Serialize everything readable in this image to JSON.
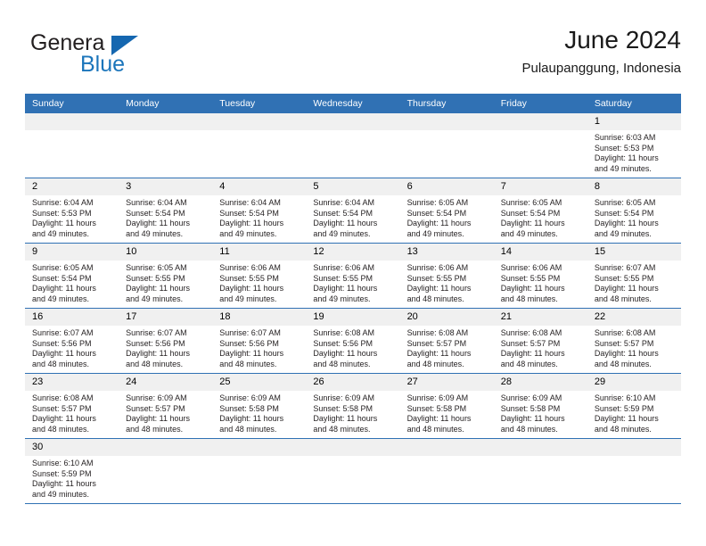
{
  "brand": {
    "name_top": "General",
    "name_bottom": "Blue",
    "accent_color": "#1b75bb"
  },
  "header": {
    "title": "June 2024",
    "subtitle": "Pulaupanggung, Indonesia"
  },
  "theme": {
    "header_blue": "#3071b4",
    "daynum_gray": "#f0f0f0",
    "text": "#231f20"
  },
  "weekday_headers": [
    "Sunday",
    "Monday",
    "Tuesday",
    "Wednesday",
    "Thursday",
    "Friday",
    "Saturday"
  ],
  "labels": {
    "sunrise_prefix": "Sunrise:",
    "sunset_prefix": "Sunset:",
    "daylight_prefix": "Daylight:"
  },
  "weeks": [
    [
      {
        "day": "",
        "empty": true,
        "sunrise": "",
        "sunset": "",
        "daylight_line1": "",
        "daylight_line2": ""
      },
      {
        "day": "",
        "empty": true,
        "sunrise": "",
        "sunset": "",
        "daylight_line1": "",
        "daylight_line2": ""
      },
      {
        "day": "",
        "empty": true,
        "sunrise": "",
        "sunset": "",
        "daylight_line1": "",
        "daylight_line2": ""
      },
      {
        "day": "",
        "empty": true,
        "sunrise": "",
        "sunset": "",
        "daylight_line1": "",
        "daylight_line2": ""
      },
      {
        "day": "",
        "empty": true,
        "sunrise": "",
        "sunset": "",
        "daylight_line1": "",
        "daylight_line2": ""
      },
      {
        "day": "",
        "empty": true,
        "sunrise": "",
        "sunset": "",
        "daylight_line1": "",
        "daylight_line2": ""
      },
      {
        "day": "1",
        "empty": false,
        "sunrise": "Sunrise: 6:03 AM",
        "sunset": "Sunset: 5:53 PM",
        "daylight_line1": "Daylight: 11 hours",
        "daylight_line2": "and 49 minutes."
      }
    ],
    [
      {
        "day": "2",
        "empty": false,
        "sunrise": "Sunrise: 6:04 AM",
        "sunset": "Sunset: 5:53 PM",
        "daylight_line1": "Daylight: 11 hours",
        "daylight_line2": "and 49 minutes."
      },
      {
        "day": "3",
        "empty": false,
        "sunrise": "Sunrise: 6:04 AM",
        "sunset": "Sunset: 5:54 PM",
        "daylight_line1": "Daylight: 11 hours",
        "daylight_line2": "and 49 minutes."
      },
      {
        "day": "4",
        "empty": false,
        "sunrise": "Sunrise: 6:04 AM",
        "sunset": "Sunset: 5:54 PM",
        "daylight_line1": "Daylight: 11 hours",
        "daylight_line2": "and 49 minutes."
      },
      {
        "day": "5",
        "empty": false,
        "sunrise": "Sunrise: 6:04 AM",
        "sunset": "Sunset: 5:54 PM",
        "daylight_line1": "Daylight: 11 hours",
        "daylight_line2": "and 49 minutes."
      },
      {
        "day": "6",
        "empty": false,
        "sunrise": "Sunrise: 6:05 AM",
        "sunset": "Sunset: 5:54 PM",
        "daylight_line1": "Daylight: 11 hours",
        "daylight_line2": "and 49 minutes."
      },
      {
        "day": "7",
        "empty": false,
        "sunrise": "Sunrise: 6:05 AM",
        "sunset": "Sunset: 5:54 PM",
        "daylight_line1": "Daylight: 11 hours",
        "daylight_line2": "and 49 minutes."
      },
      {
        "day": "8",
        "empty": false,
        "sunrise": "Sunrise: 6:05 AM",
        "sunset": "Sunset: 5:54 PM",
        "daylight_line1": "Daylight: 11 hours",
        "daylight_line2": "and 49 minutes."
      }
    ],
    [
      {
        "day": "9",
        "empty": false,
        "sunrise": "Sunrise: 6:05 AM",
        "sunset": "Sunset: 5:54 PM",
        "daylight_line1": "Daylight: 11 hours",
        "daylight_line2": "and 49 minutes."
      },
      {
        "day": "10",
        "empty": false,
        "sunrise": "Sunrise: 6:05 AM",
        "sunset": "Sunset: 5:55 PM",
        "daylight_line1": "Daylight: 11 hours",
        "daylight_line2": "and 49 minutes."
      },
      {
        "day": "11",
        "empty": false,
        "sunrise": "Sunrise: 6:06 AM",
        "sunset": "Sunset: 5:55 PM",
        "daylight_line1": "Daylight: 11 hours",
        "daylight_line2": "and 49 minutes."
      },
      {
        "day": "12",
        "empty": false,
        "sunrise": "Sunrise: 6:06 AM",
        "sunset": "Sunset: 5:55 PM",
        "daylight_line1": "Daylight: 11 hours",
        "daylight_line2": "and 49 minutes."
      },
      {
        "day": "13",
        "empty": false,
        "sunrise": "Sunrise: 6:06 AM",
        "sunset": "Sunset: 5:55 PM",
        "daylight_line1": "Daylight: 11 hours",
        "daylight_line2": "and 48 minutes."
      },
      {
        "day": "14",
        "empty": false,
        "sunrise": "Sunrise: 6:06 AM",
        "sunset": "Sunset: 5:55 PM",
        "daylight_line1": "Daylight: 11 hours",
        "daylight_line2": "and 48 minutes."
      },
      {
        "day": "15",
        "empty": false,
        "sunrise": "Sunrise: 6:07 AM",
        "sunset": "Sunset: 5:55 PM",
        "daylight_line1": "Daylight: 11 hours",
        "daylight_line2": "and 48 minutes."
      }
    ],
    [
      {
        "day": "16",
        "empty": false,
        "sunrise": "Sunrise: 6:07 AM",
        "sunset": "Sunset: 5:56 PM",
        "daylight_line1": "Daylight: 11 hours",
        "daylight_line2": "and 48 minutes."
      },
      {
        "day": "17",
        "empty": false,
        "sunrise": "Sunrise: 6:07 AM",
        "sunset": "Sunset: 5:56 PM",
        "daylight_line1": "Daylight: 11 hours",
        "daylight_line2": "and 48 minutes."
      },
      {
        "day": "18",
        "empty": false,
        "sunrise": "Sunrise: 6:07 AM",
        "sunset": "Sunset: 5:56 PM",
        "daylight_line1": "Daylight: 11 hours",
        "daylight_line2": "and 48 minutes."
      },
      {
        "day": "19",
        "empty": false,
        "sunrise": "Sunrise: 6:08 AM",
        "sunset": "Sunset: 5:56 PM",
        "daylight_line1": "Daylight: 11 hours",
        "daylight_line2": "and 48 minutes."
      },
      {
        "day": "20",
        "empty": false,
        "sunrise": "Sunrise: 6:08 AM",
        "sunset": "Sunset: 5:57 PM",
        "daylight_line1": "Daylight: 11 hours",
        "daylight_line2": "and 48 minutes."
      },
      {
        "day": "21",
        "empty": false,
        "sunrise": "Sunrise: 6:08 AM",
        "sunset": "Sunset: 5:57 PM",
        "daylight_line1": "Daylight: 11 hours",
        "daylight_line2": "and 48 minutes."
      },
      {
        "day": "22",
        "empty": false,
        "sunrise": "Sunrise: 6:08 AM",
        "sunset": "Sunset: 5:57 PM",
        "daylight_line1": "Daylight: 11 hours",
        "daylight_line2": "and 48 minutes."
      }
    ],
    [
      {
        "day": "23",
        "empty": false,
        "sunrise": "Sunrise: 6:08 AM",
        "sunset": "Sunset: 5:57 PM",
        "daylight_line1": "Daylight: 11 hours",
        "daylight_line2": "and 48 minutes."
      },
      {
        "day": "24",
        "empty": false,
        "sunrise": "Sunrise: 6:09 AM",
        "sunset": "Sunset: 5:57 PM",
        "daylight_line1": "Daylight: 11 hours",
        "daylight_line2": "and 48 minutes."
      },
      {
        "day": "25",
        "empty": false,
        "sunrise": "Sunrise: 6:09 AM",
        "sunset": "Sunset: 5:58 PM",
        "daylight_line1": "Daylight: 11 hours",
        "daylight_line2": "and 48 minutes."
      },
      {
        "day": "26",
        "empty": false,
        "sunrise": "Sunrise: 6:09 AM",
        "sunset": "Sunset: 5:58 PM",
        "daylight_line1": "Daylight: 11 hours",
        "daylight_line2": "and 48 minutes."
      },
      {
        "day": "27",
        "empty": false,
        "sunrise": "Sunrise: 6:09 AM",
        "sunset": "Sunset: 5:58 PM",
        "daylight_line1": "Daylight: 11 hours",
        "daylight_line2": "and 48 minutes."
      },
      {
        "day": "28",
        "empty": false,
        "sunrise": "Sunrise: 6:09 AM",
        "sunset": "Sunset: 5:58 PM",
        "daylight_line1": "Daylight: 11 hours",
        "daylight_line2": "and 48 minutes."
      },
      {
        "day": "29",
        "empty": false,
        "sunrise": "Sunrise: 6:10 AM",
        "sunset": "Sunset: 5:59 PM",
        "daylight_line1": "Daylight: 11 hours",
        "daylight_line2": "and 48 minutes."
      }
    ],
    [
      {
        "day": "30",
        "empty": false,
        "sunrise": "Sunrise: 6:10 AM",
        "sunset": "Sunset: 5:59 PM",
        "daylight_line1": "Daylight: 11 hours",
        "daylight_line2": "and 49 minutes."
      },
      {
        "day": "",
        "empty": true,
        "sunrise": "",
        "sunset": "",
        "daylight_line1": "",
        "daylight_line2": ""
      },
      {
        "day": "",
        "empty": true,
        "sunrise": "",
        "sunset": "",
        "daylight_line1": "",
        "daylight_line2": ""
      },
      {
        "day": "",
        "empty": true,
        "sunrise": "",
        "sunset": "",
        "daylight_line1": "",
        "daylight_line2": ""
      },
      {
        "day": "",
        "empty": true,
        "sunrise": "",
        "sunset": "",
        "daylight_line1": "",
        "daylight_line2": ""
      },
      {
        "day": "",
        "empty": true,
        "sunrise": "",
        "sunset": "",
        "daylight_line1": "",
        "daylight_line2": ""
      },
      {
        "day": "",
        "empty": true,
        "sunrise": "",
        "sunset": "",
        "daylight_line1": "",
        "daylight_line2": ""
      }
    ]
  ]
}
